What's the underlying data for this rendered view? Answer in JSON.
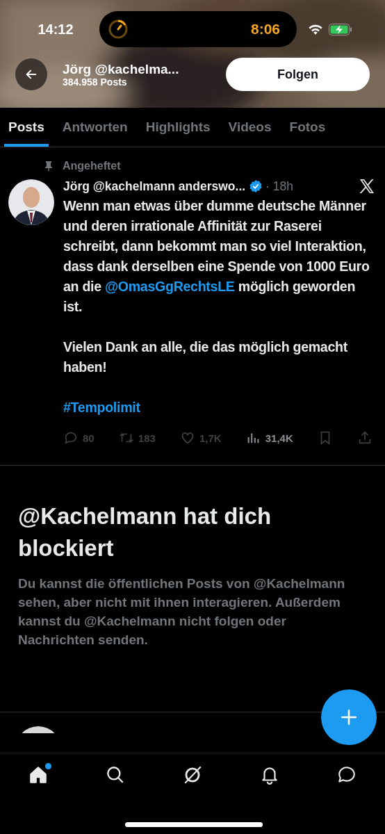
{
  "status_bar": {
    "time": "14:12",
    "timer": "8:06"
  },
  "header": {
    "name": "Jörg @kachelma...",
    "posts": "384.958 Posts",
    "follow": "Folgen"
  },
  "tabs": [
    {
      "label": "Posts",
      "selected": true
    },
    {
      "label": "Antworten",
      "selected": false
    },
    {
      "label": "Highlights",
      "selected": false
    },
    {
      "label": "Videos",
      "selected": false
    },
    {
      "label": "Fotos",
      "selected": false
    }
  ],
  "pinned_post": {
    "pinned_label": "Angeheftet",
    "author": "Jörg @kachelmann anderswo...",
    "verified": true,
    "time": "· 18h",
    "paragraphs": [
      [
        {
          "kind": "plain",
          "text": "Wenn man etwas über dumme deutsche Männer und deren irrationale Affinität zur Raserei schreibt, dann bekommt man so viel Interaktion, dass dank derselben eine Spende von 1000 Euro an die "
        },
        {
          "kind": "mention",
          "text": "@OmasGgRechtsLE"
        },
        {
          "kind": "plain",
          "text": " möglich geworden ist."
        }
      ],
      [
        {
          "kind": "plain",
          "text": "Vielen Dank an alle, die das möglich gemacht haben!"
        }
      ],
      [
        {
          "kind": "mention",
          "text": "#Tempolimit"
        }
      ]
    ],
    "actions": [
      {
        "kind": "reply",
        "count": "80"
      },
      {
        "kind": "repost",
        "count": "183"
      },
      {
        "kind": "like",
        "count": "1,7K"
      },
      {
        "kind": "views",
        "count": "31,4K"
      },
      {
        "kind": "bookmark"
      },
      {
        "kind": "share"
      }
    ]
  },
  "blocked": {
    "title": "@Kachelmann hat dich blockiert",
    "text": "Du kannst die öffentlichen Posts von @Kachelmann sehen, aber nicht mit ihnen interagieren. Außerdem kannst du @Kachelmann nicht folgen oder Nachrichten senden."
  },
  "bottom_nav": [
    {
      "kind": "home",
      "selected": true,
      "badge": true
    },
    {
      "kind": "search",
      "selected": false,
      "badge": false
    },
    {
      "kind": "grok",
      "selected": false,
      "badge": false
    },
    {
      "kind": "notifications",
      "selected": false,
      "badge": false
    },
    {
      "kind": "messages",
      "selected": false,
      "badge": false
    }
  ]
}
